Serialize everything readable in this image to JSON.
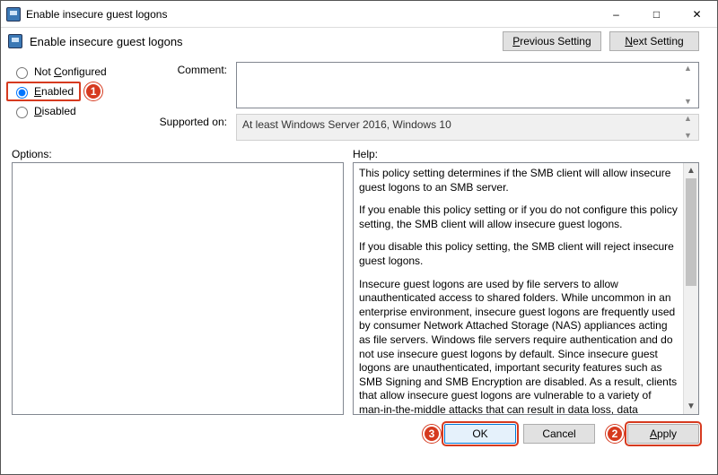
{
  "window": {
    "title": "Enable insecure guest logons"
  },
  "toolbar": {
    "title": "Enable insecure guest logons",
    "prev_label": "Previous Setting",
    "next_label": "Next Setting",
    "prev_u": "P",
    "next_u": "N"
  },
  "radios": {
    "not_configured": {
      "label_pre": "Not ",
      "u": "C",
      "label_post": "onfigured"
    },
    "enabled": {
      "u": "E",
      "label_post": "nabled"
    },
    "disabled": {
      "u": "D",
      "label_post": "isabled"
    },
    "selected": "enabled"
  },
  "comment": {
    "label": "Comment:",
    "value": ""
  },
  "supported": {
    "label": "Supported on:",
    "text": "At least Windows Server 2016, Windows 10"
  },
  "sections": {
    "options_label": "Options:",
    "help_label": "Help:"
  },
  "help_paragraphs": [
    "This policy setting determines if the SMB client will allow insecure guest logons to an SMB server.",
    "If you enable this policy setting or if you do not configure this policy setting, the SMB client will allow insecure guest logons.",
    "If you disable this policy setting, the SMB client will reject insecure guest logons.",
    "Insecure guest logons are used by file servers to allow unauthenticated access to shared folders. While uncommon in an enterprise environment, insecure guest logons are frequently used by consumer Network Attached Storage (NAS) appliances acting as file servers. Windows file servers require authentication and do not use insecure guest logons by default. Since insecure guest logons are unauthenticated, important security features such as SMB Signing and SMB Encryption are disabled. As a result, clients that allow insecure guest logons are vulnerable to a variety of man-in-the-middle attacks that can result in data loss, data corruption, and exposure to malware. Additionally, any data written to a file server using an insecure guest logon is"
  ],
  "footer": {
    "ok": "OK",
    "cancel": "Cancel",
    "apply": "Apply",
    "apply_u": "A"
  },
  "annotations": {
    "b1": "1",
    "b2": "2",
    "b3": "3"
  }
}
